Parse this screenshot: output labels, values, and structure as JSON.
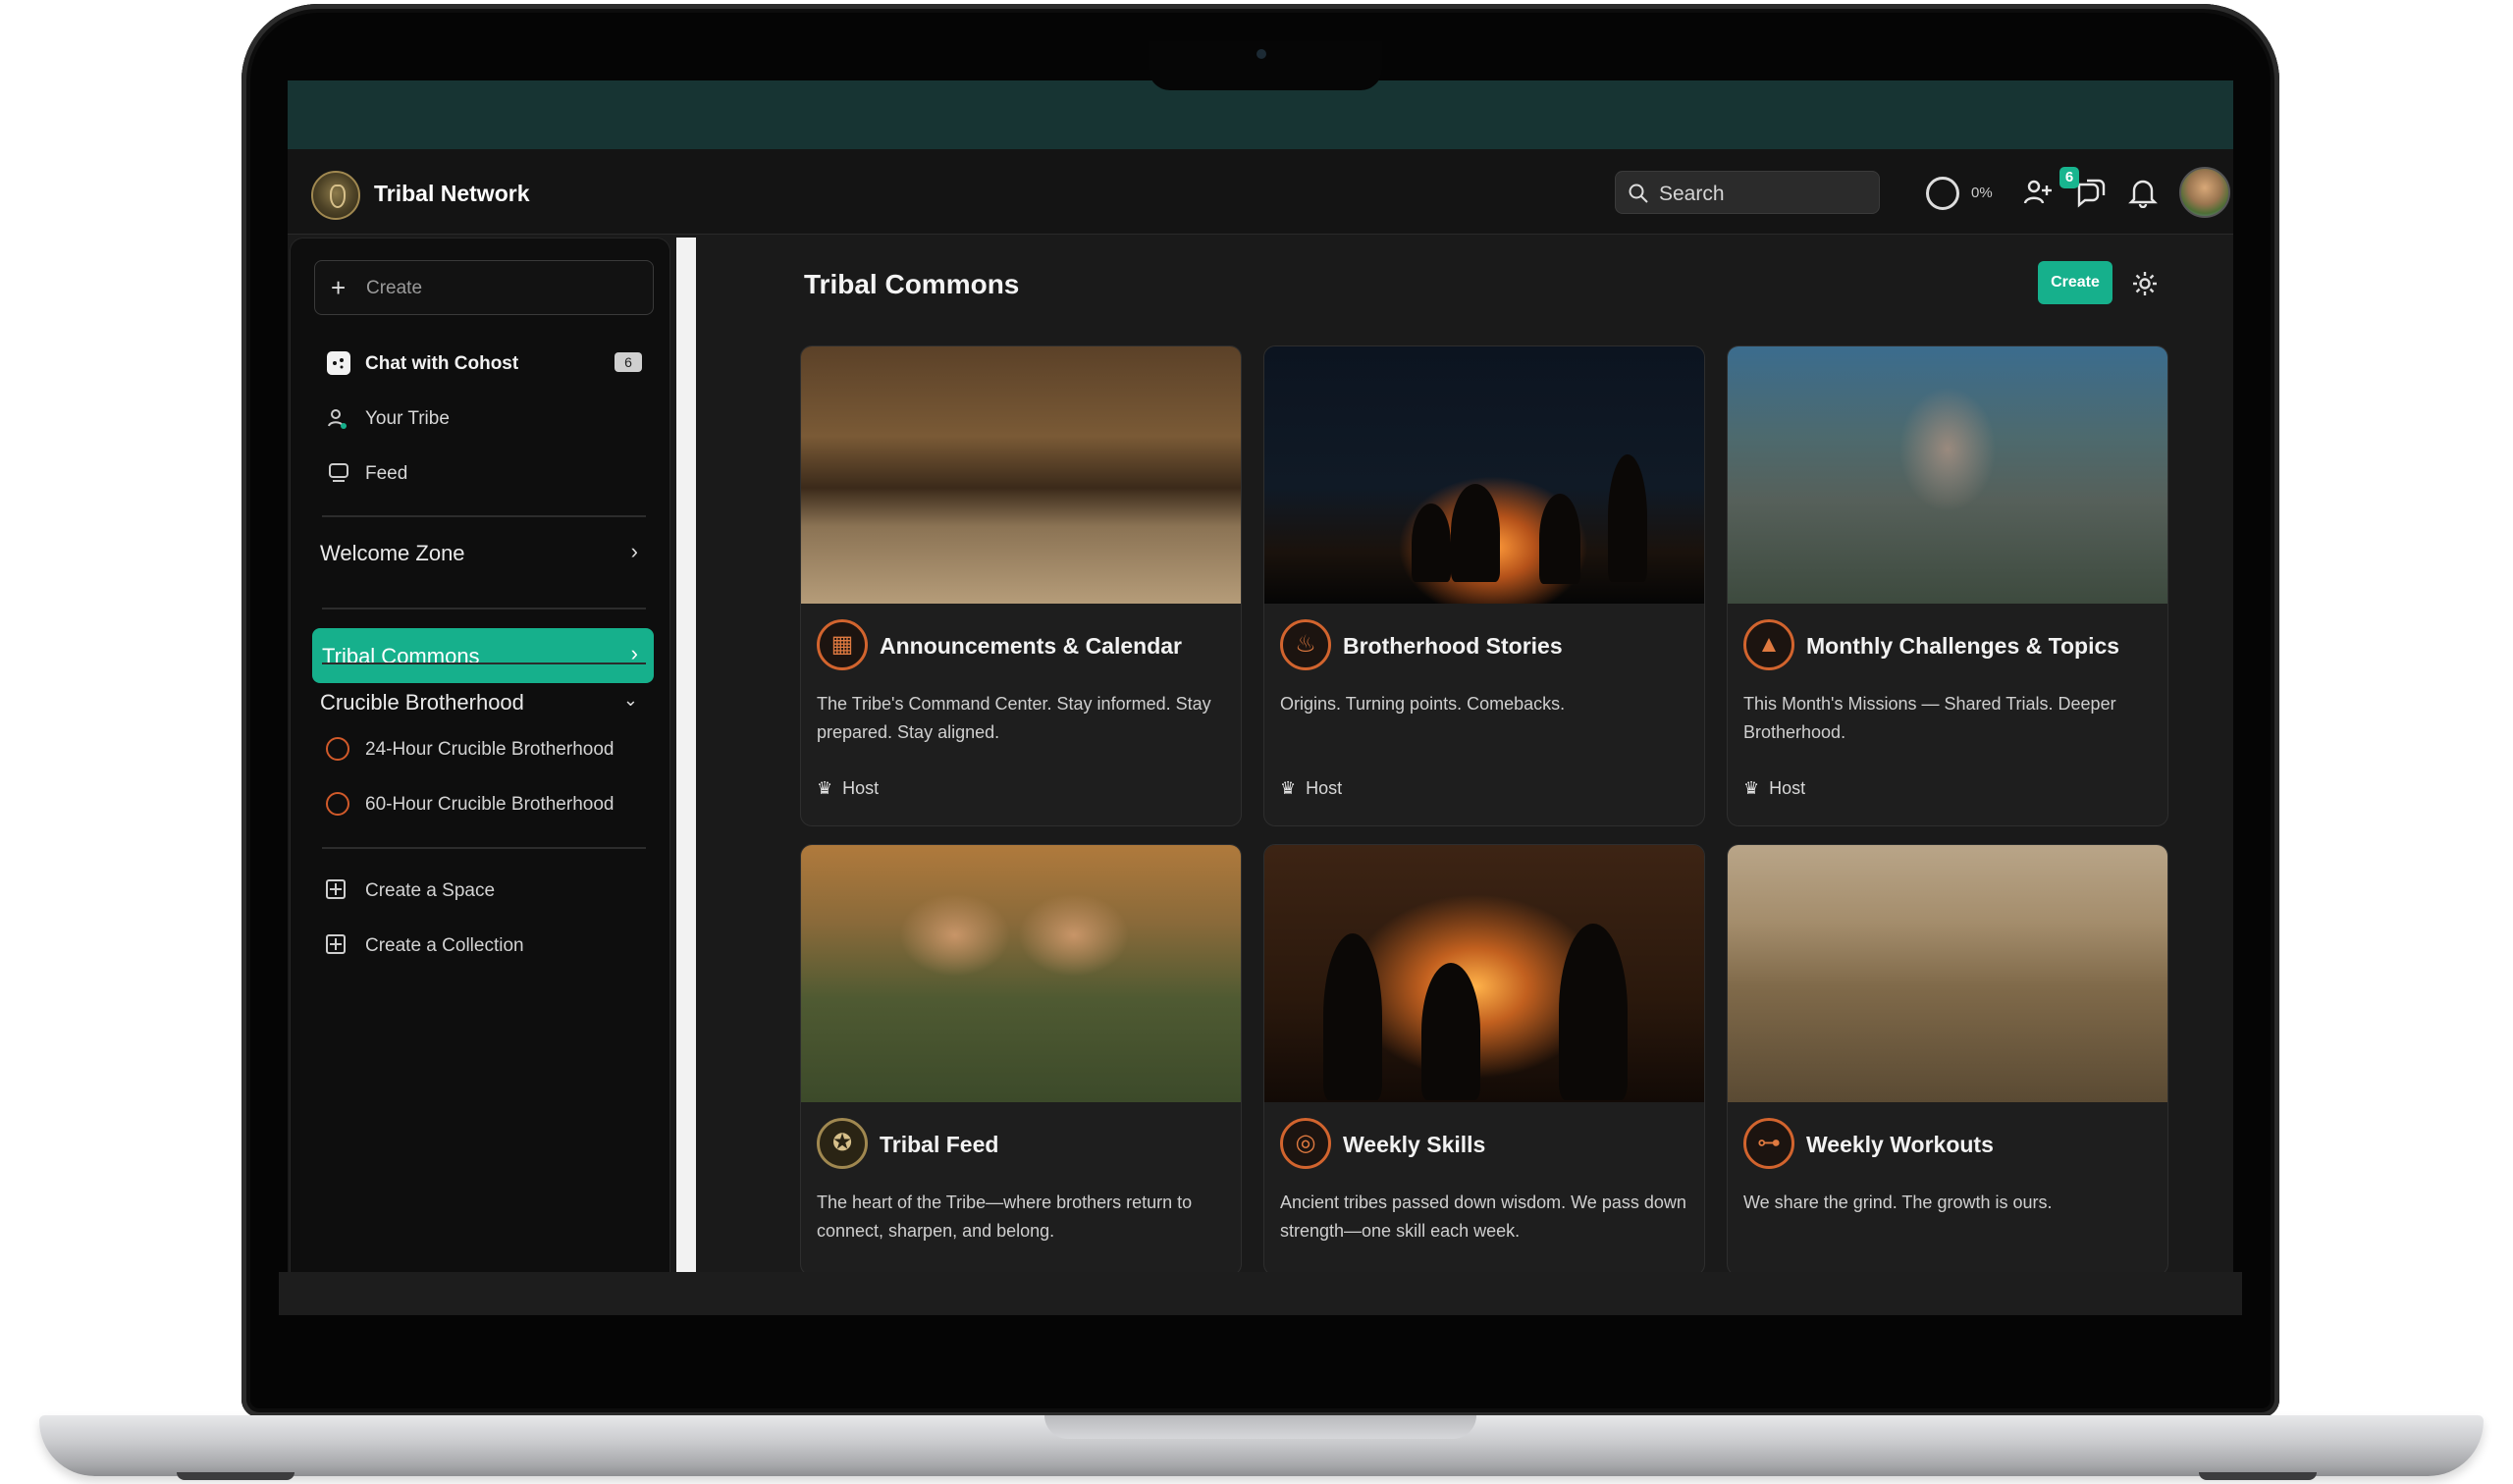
{
  "app": {
    "title": "Tribal Network"
  },
  "topbar": {
    "search_placeholder": "Search",
    "progress": "0%",
    "requests_badge": "6"
  },
  "sidebar": {
    "create_label": "Create",
    "items": [
      {
        "label": "Chat with Cohost",
        "count": "6"
      },
      {
        "label": "Your Tribe"
      },
      {
        "label": "Feed"
      }
    ],
    "welcome_zone": "Welcome Zone",
    "active": "Tribal Commons",
    "crucible": {
      "label": "Crucible Brotherhood",
      "children": [
        "24-Hour Crucible Brotherhood",
        "60-Hour Crucible Brotherhood"
      ]
    },
    "create_space": "Create a Space",
    "create_collection": "Create a Collection"
  },
  "main": {
    "title": "Tribal Commons",
    "create_button": "Create",
    "cards": [
      {
        "title": "Announcements & Calendar",
        "desc": "The Tribe's Command Center. Stay informed. Stay prepared. Stay aligned.",
        "host": "Host",
        "icon": "calendar-icon"
      },
      {
        "title": "Brotherhood Stories",
        "desc": "Origins. Turning points. Comebacks.",
        "host": "Host",
        "icon": "campfire-icon"
      },
      {
        "title": "Monthly Challenges & Topics",
        "desc": "This Month's Missions — Shared Trials. Deeper Brotherhood.",
        "host": "Host",
        "icon": "mountain-icon"
      },
      {
        "title": "Tribal Feed",
        "desc": "The heart of the Tribe—where brothers return to connect, sharpen, and belong.",
        "icon": "tribe-emblem-icon"
      },
      {
        "title": "Weekly Skills",
        "desc": "Ancient tribes passed down wisdom. We pass down strength—one skill each week.",
        "icon": "target-icon"
      },
      {
        "title": "Weekly Workouts",
        "desc": "We share the grind. The growth is ours.",
        "icon": "dumbbell-icon"
      }
    ]
  },
  "colors": {
    "accent": "#16b08c",
    "icon_orange": "#d2642e",
    "background": "#1a1a1a"
  }
}
